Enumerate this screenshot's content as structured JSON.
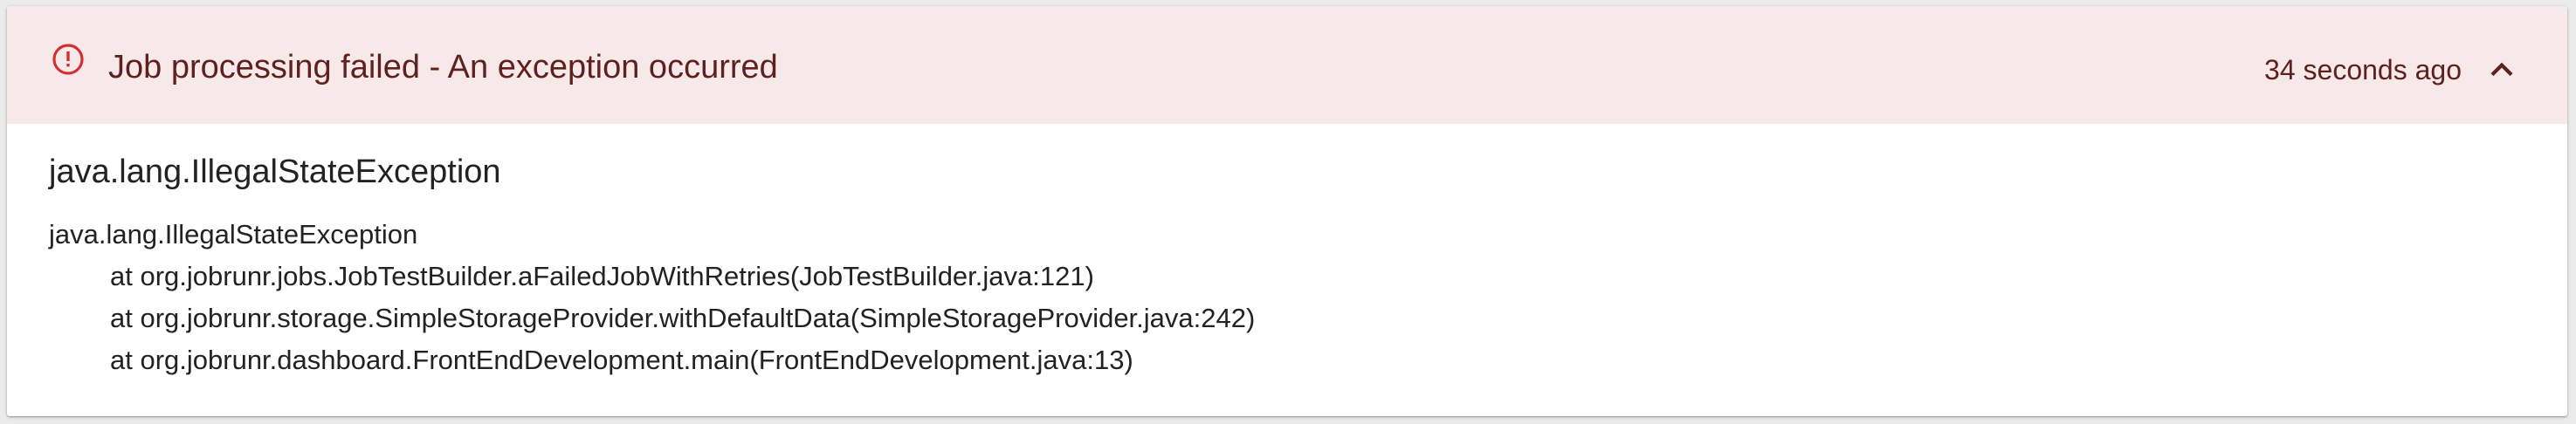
{
  "notification": {
    "title": "Job processing failed - An exception occurred",
    "time_ago": "34 seconds ago",
    "icon": "error-outline-icon",
    "collapse_icon": "chevron-up-icon",
    "colors": {
      "header_bg": "#f7e9e9",
      "icon": "#d32f2f",
      "header_text": "#5f2120"
    }
  },
  "exception": {
    "type": "java.lang.IllegalStateException",
    "stacktrace": [
      "java.lang.IllegalStateException",
      "at org.jobrunr.jobs.JobTestBuilder.aFailedJobWithRetries(JobTestBuilder.java:121)",
      "at org.jobrunr.storage.SimpleStorageProvider.withDefaultData(SimpleStorageProvider.java:242)",
      "at org.jobrunr.dashboard.FrontEndDevelopment.main(FrontEndDevelopment.java:13)"
    ]
  }
}
